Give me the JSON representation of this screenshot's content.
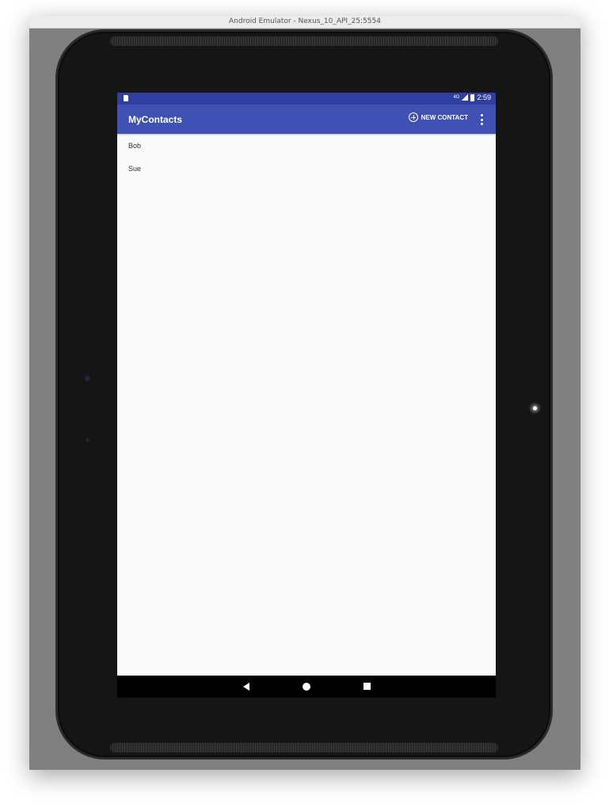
{
  "window": {
    "title": "Android Emulator - Nexus_10_API_25:5554"
  },
  "status_bar": {
    "time": "2:59",
    "network_label": "4G"
  },
  "app_bar": {
    "title": "MyContacts",
    "new_contact_label": "NEW CONTACT"
  },
  "contacts": [
    {
      "name": "Bob"
    },
    {
      "name": "Sue"
    }
  ],
  "colors": {
    "primary": "#3f51b5",
    "primary_dark": "#303f9f",
    "background": "#fafafa"
  },
  "icons": {
    "status": [
      "sd-card-icon",
      "network-4g-icon",
      "signal-icon",
      "battery-icon"
    ],
    "toolbar": [
      "add-circle-icon",
      "more-vert-icon"
    ],
    "nav": [
      "back-icon",
      "home-icon",
      "recents-icon"
    ]
  }
}
